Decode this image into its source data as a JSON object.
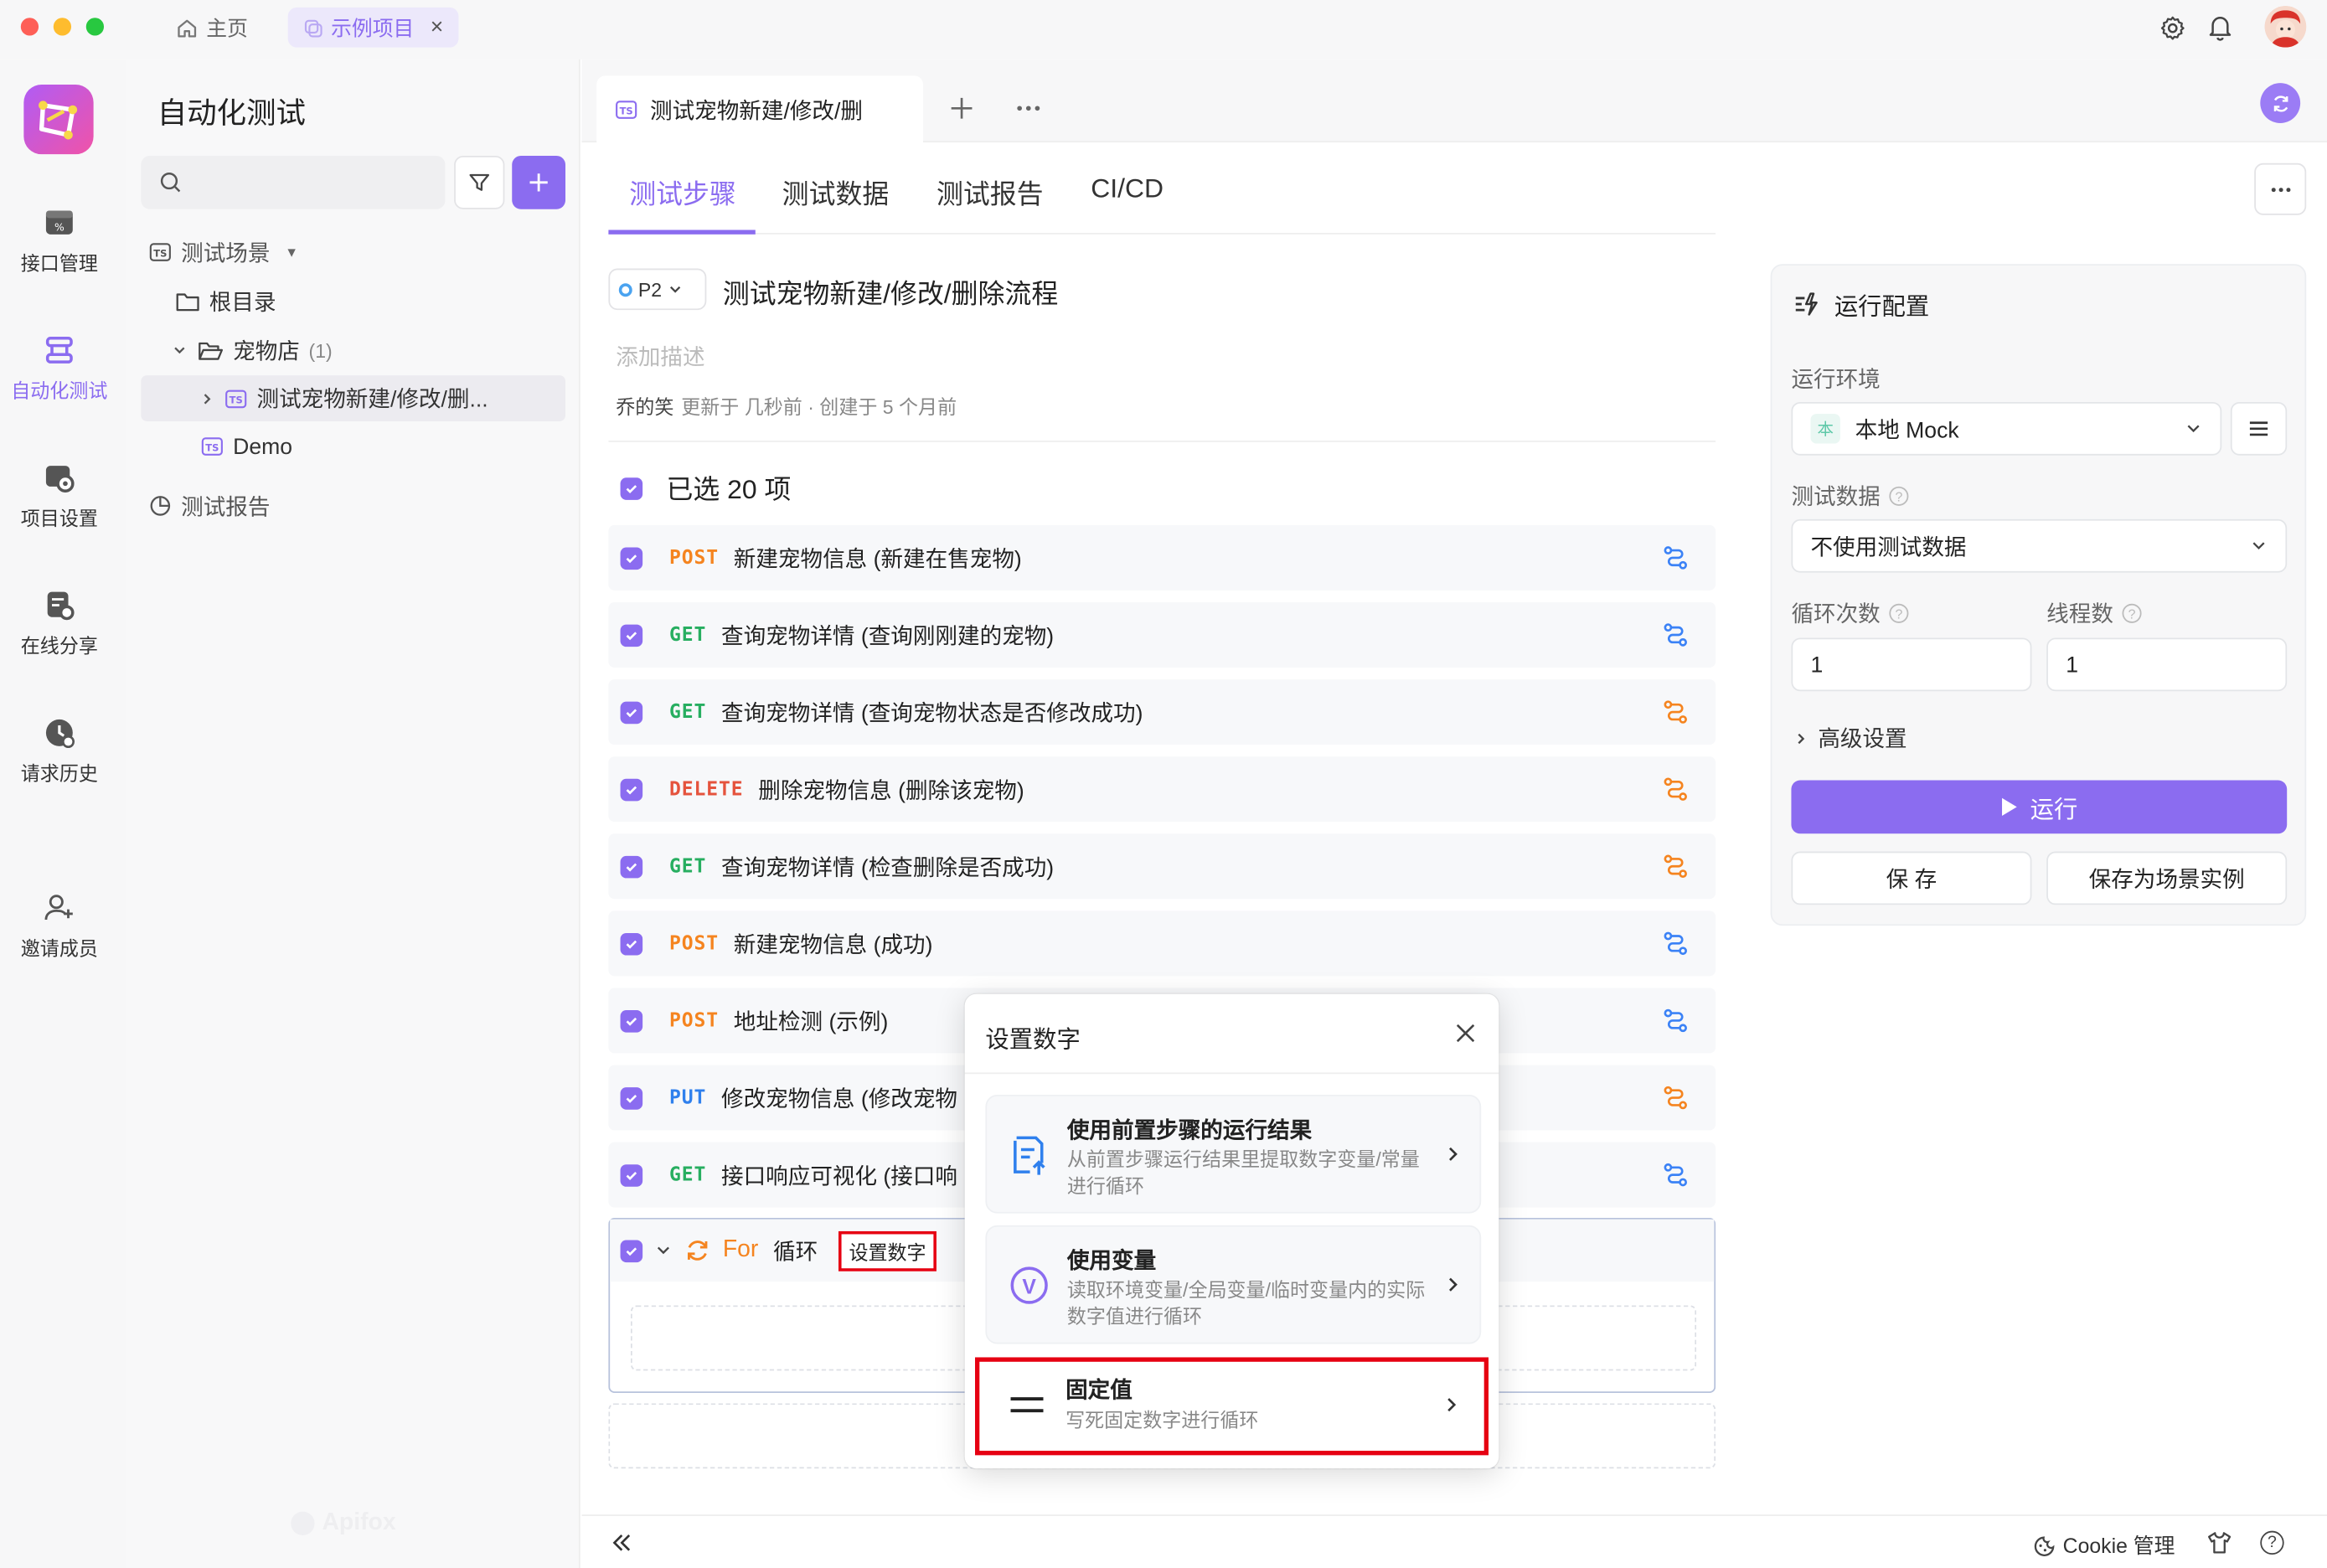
{
  "titlebar": {
    "home_tab": "主页",
    "project_tab": "示例项目"
  },
  "rail": {
    "items": [
      {
        "label": "接口管理"
      },
      {
        "label": "自动化测试"
      },
      {
        "label": "项目设置"
      },
      {
        "label": "在线分享"
      },
      {
        "label": "请求历史"
      },
      {
        "label": "邀请成员"
      }
    ]
  },
  "sidebar": {
    "title": "自动化测试",
    "search_placeholder": "",
    "tree": {
      "scenes": "测试场景",
      "root": "根目录",
      "petshop": "宠物店",
      "petshop_count": "(1)",
      "scene_item": "测试宠物新建/修改/删...",
      "demo": "Demo",
      "reports": "测试报告"
    },
    "watermark": "Apifox"
  },
  "main": {
    "doc_tab": "测试宠物新建/修改/删",
    "subtabs": [
      "测试步骤",
      "测试数据",
      "测试报告",
      "CI/CD"
    ],
    "priority": "P2",
    "scene_title": "测试宠物新建/修改/删除流程",
    "desc_placeholder": "添加描述",
    "author": "乔的笑",
    "meta": "更新于 几秒前 · 创建于 5 个月前",
    "selected": "已选 20 项",
    "steps": [
      {
        "method": "POST",
        "color": "#f5841f",
        "text": "新建宠物信息 (新建在售宠物)",
        "icon_color": "#3b82f6"
      },
      {
        "method": "GET",
        "color": "#27ae60",
        "text": "查询宠物详情 (查询刚刚建的宠物)",
        "icon_color": "#3b82f6"
      },
      {
        "method": "GET",
        "color": "#27ae60",
        "text": "查询宠物详情 (查询宠物状态是否修改成功)",
        "icon_color": "#f5841f"
      },
      {
        "method": "DELETE",
        "color": "#e5533d",
        "text": "删除宠物信息 (删除该宠物)",
        "icon_color": "#f5841f"
      },
      {
        "method": "GET",
        "color": "#27ae60",
        "text": "查询宠物详情 (检查删除是否成功)",
        "icon_color": "#f5841f"
      },
      {
        "method": "POST",
        "color": "#f5841f",
        "text": "新建宠物信息 (成功)",
        "icon_color": "#3b82f6"
      },
      {
        "method": "POST",
        "color": "#f5841f",
        "text": "地址检测 (示例)",
        "icon_color": "#3b82f6"
      },
      {
        "method": "PUT",
        "color": "#2f80ed",
        "text": "修改宠物信息 (修改宠物",
        "icon_color": "#f5841f"
      },
      {
        "method": "GET",
        "color": "#27ae60",
        "text": "接口响应可视化 (接口响",
        "icon_color": "#3b82f6"
      }
    ],
    "loop": {
      "keyword": "For",
      "label": "循环",
      "set_number": "设置数字"
    }
  },
  "config": {
    "title": "运行配置",
    "env_label": "运行环境",
    "env_badge": "本",
    "env_value": "本地 Mock",
    "data_label": "测试数据",
    "data_value": "不使用测试数据",
    "loops_label": "循环次数",
    "loops_value": "1",
    "threads_label": "线程数",
    "threads_value": "1",
    "advanced": "高级设置",
    "run": "运行",
    "save": "保 存",
    "save_as": "保存为场景实例"
  },
  "modal": {
    "title": "设置数字",
    "options": [
      {
        "title": "使用前置步骤的运行结果",
        "desc": "从前置步骤运行结果里提取数字变量/常量进行循环"
      },
      {
        "title": "使用变量",
        "desc": "读取环境变量/全局变量/临时变量内的实际数字值进行循环"
      },
      {
        "title": "固定值",
        "desc": "写死固定数字进行循环"
      }
    ]
  },
  "footer": {
    "cookie": "Cookie 管理"
  },
  "colors": {
    "accent": "#8b6cf0",
    "highlight_red": "#e60012"
  }
}
